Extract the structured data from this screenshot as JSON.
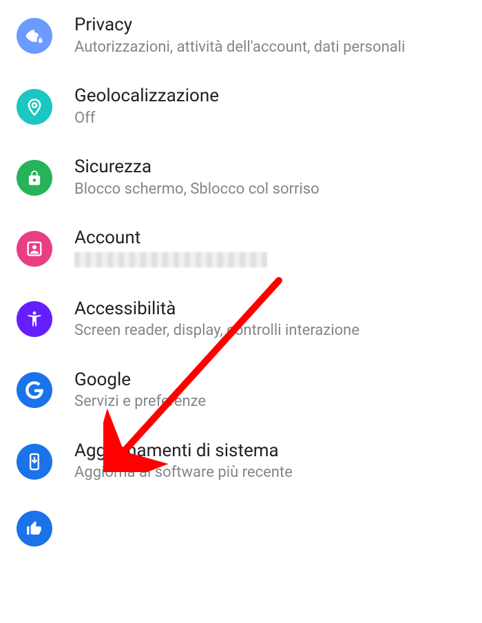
{
  "settings": {
    "items": [
      {
        "key": "privacy",
        "title": "Privacy",
        "subtitle": "Autorizzazioni, attività dell'account, dati personali",
        "icon": "eye-lock-icon",
        "bg": "bg-privacy"
      },
      {
        "key": "geo",
        "title": "Geolocalizzazione",
        "subtitle": "Off",
        "icon": "location-pin-icon",
        "bg": "bg-geo"
      },
      {
        "key": "security",
        "title": "Sicurezza",
        "subtitle": "Blocco schermo, Sblocco col sorriso",
        "icon": "lock-icon",
        "bg": "bg-security"
      },
      {
        "key": "account",
        "title": "Account",
        "subtitle": "",
        "icon": "person-box-icon",
        "bg": "bg-account",
        "blurred": true
      },
      {
        "key": "accessibility",
        "title": "Accessibilità",
        "subtitle": "Screen reader, display, controlli interazione",
        "icon": "accessibility-icon",
        "bg": "bg-accessibility"
      },
      {
        "key": "google",
        "title": "Google",
        "subtitle": "Servizi e preferenze",
        "icon": "google-g-icon",
        "bg": "bg-google"
      },
      {
        "key": "update",
        "title": "Aggiornamenti di sistema",
        "subtitle": "Aggiorna al software più recente",
        "icon": "system-update-icon",
        "bg": "bg-update"
      },
      {
        "key": "rate",
        "title": "",
        "subtitle": "",
        "icon": "thumb-up-icon",
        "bg": "bg-rate"
      }
    ]
  },
  "annotation": {
    "arrow_target": "google",
    "color": "#ff0000"
  }
}
